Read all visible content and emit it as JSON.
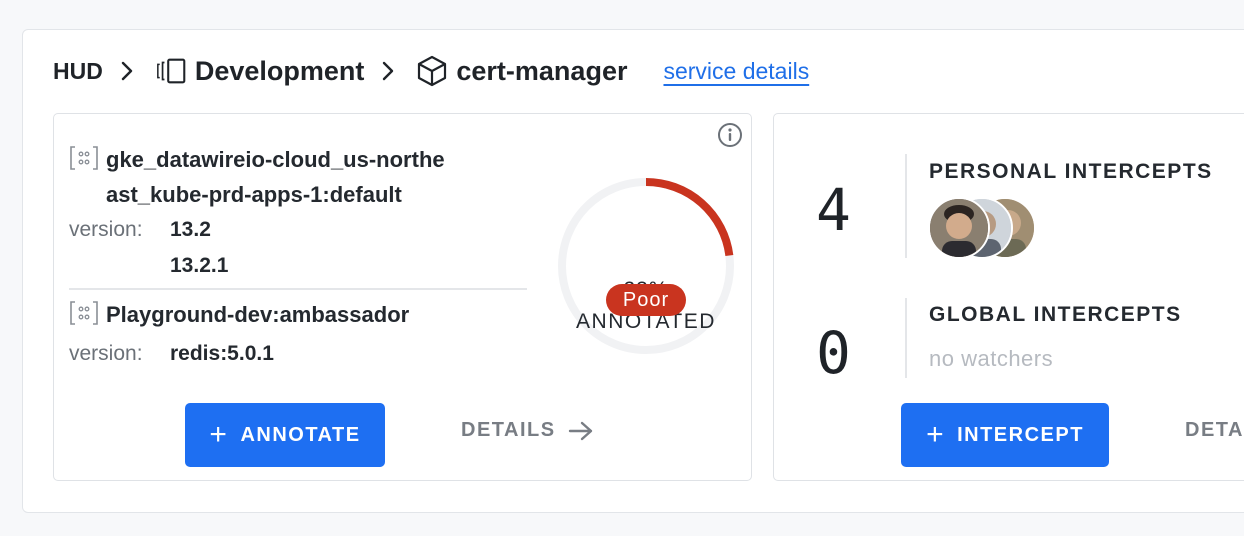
{
  "breadcrumb": {
    "root": "HUD",
    "environment": "Development",
    "service": "cert-manager",
    "link": "service details"
  },
  "clusters": [
    {
      "name_line1": "gke_datawireio-cloud_us-northe",
      "name_line2": "ast_kube-prd-apps-1:default",
      "version_label": "version:",
      "versions": [
        "13.2",
        "13.2.1"
      ]
    },
    {
      "name_line1": "Playground-dev:ambassador",
      "version_label": "version:",
      "versions": [
        "redis:5.0.1"
      ]
    }
  ],
  "annotation": {
    "percent_text": "23%",
    "percent_value": 23,
    "label": "ANNOTATED",
    "rating": "Poor",
    "rating_color": "#c9341f"
  },
  "actions_left": {
    "annotate_label": "ANNOTATE",
    "details_label": "DETAILS"
  },
  "intercepts": {
    "personal_count": "4",
    "personal_title": "PERSONAL INTERCEPTS",
    "global_count": "0",
    "global_title": "GLOBAL INTERCEPTS",
    "global_empty": "no watchers"
  },
  "actions_right": {
    "intercept_label": "INTERCEPT",
    "details_label": "DETA"
  },
  "colors": {
    "primary": "#1e6ff2",
    "link": "#1f6fe8",
    "gauge_fill": "#c9341f",
    "gauge_track": "#f1f2f4"
  },
  "icons": [
    "chevron-right-icon",
    "environment-icon",
    "cube-icon",
    "cluster-icon",
    "info-icon",
    "plus-icon",
    "arrow-right-icon"
  ]
}
